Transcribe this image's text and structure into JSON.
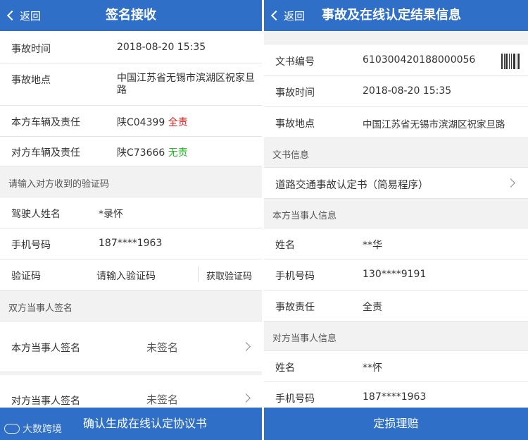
{
  "left": {
    "back_label": "返回",
    "title": "签名接收",
    "info": [
      {
        "label": "事故时间",
        "value": "2018-08-20 15:35"
      },
      {
        "label": "事故地点",
        "value": "中国江苏省无锡市滨湖区祝家旦路"
      },
      {
        "label": "本方车辆及责任",
        "plate": "陕C04399",
        "resp": "全责"
      },
      {
        "label": "对方车辆及责任",
        "plate": "陕C73666",
        "resp": "无责"
      }
    ],
    "verify_section": "请输入对方收到的验证码",
    "driver": {
      "label": "驾驶人姓名",
      "value": "*录怀"
    },
    "phone": {
      "label": "手机号码",
      "value": "187****1963"
    },
    "code": {
      "label": "验证码",
      "placeholder": "请输入验证码",
      "button": "获取验证码"
    },
    "sign_section": "双方当事人签名",
    "sign_self": {
      "label": "本方当事人签名",
      "status": "未签名"
    },
    "sign_other": {
      "label": "对方当事人签名",
      "status": "未签名"
    },
    "footer": "确认生成在线认定协议书",
    "watermark": "大数跨境"
  },
  "right": {
    "back_label": "返回",
    "title": "事故及在线认定结果信息",
    "doc_no": {
      "label": "文书编号",
      "value": "610300420188000056"
    },
    "time": {
      "label": "事故时间",
      "value": "2018-08-20 15:35"
    },
    "place": {
      "label": "事故地点",
      "value": "中国江苏省无锡市滨湖区祝家旦路"
    },
    "doc_section": "文书信息",
    "doc_item": "道路交通事故认定书（简易程序）",
    "self_section": "本方当事人信息",
    "self_name": {
      "label": "姓名",
      "value": "**华"
    },
    "self_phone": {
      "label": "手机号码",
      "value": "130****9191"
    },
    "self_resp": {
      "label": "事故责任",
      "value": "全责"
    },
    "other_section": "对方当事人信息",
    "other_name": {
      "label": "姓名",
      "value": "**怀"
    },
    "other_phone": {
      "label": "手机号码",
      "value": "187****1963"
    },
    "footer": "定损理赔"
  },
  "colors": {
    "accent": "#2f6fc7",
    "red": "#e52020",
    "green": "#2bb52b"
  }
}
